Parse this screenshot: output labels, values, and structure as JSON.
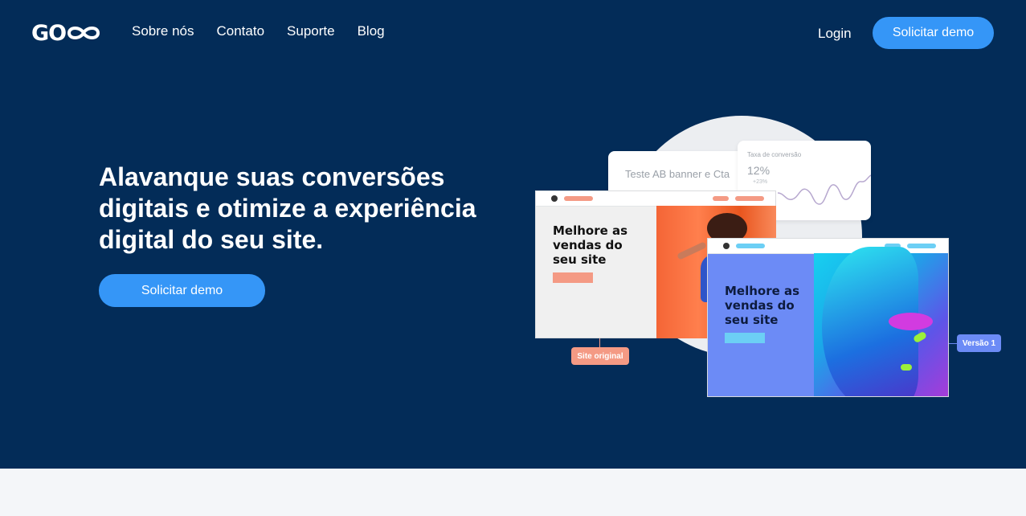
{
  "brand": {
    "logo_text": "GO"
  },
  "nav": {
    "items": [
      {
        "label": "Sobre nós"
      },
      {
        "label": "Contato"
      },
      {
        "label": "Suporte"
      },
      {
        "label": "Blog"
      }
    ],
    "login_label": "Login",
    "demo_label": "Solicitar demo"
  },
  "hero": {
    "headline": "Alavanque suas conversões digitais e otimize a experiência digital do seu site.",
    "cta_label": "Solicitar demo"
  },
  "illustration": {
    "test_card_label": "Teste AB banner e Cta",
    "rate_card": {
      "label": "Taxa de conversão",
      "value": "12%",
      "delta": "+23%"
    },
    "original_mock_text": "Melhore as vendas do seu site",
    "original_tag": "Site original",
    "variant_mock_text": "Melhore as vendas do seu site",
    "variant_tag": "Versão 1"
  },
  "colors": {
    "hero_bg": "#032c58",
    "accent": "#3596f7",
    "original_accent": "#f49a84",
    "variant_accent": "#6c8bf6"
  },
  "icons": [
    "infinity-logo-icon"
  ]
}
